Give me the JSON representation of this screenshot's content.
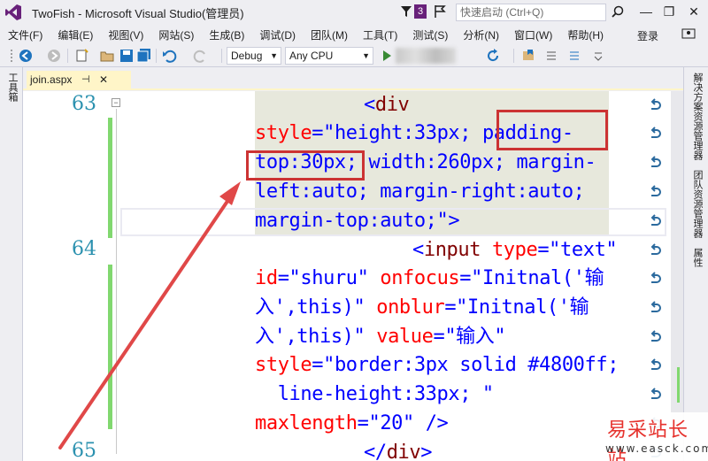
{
  "window": {
    "title": "TwoFish - Microsoft Visual Studio(管理员)",
    "notification_count": "3",
    "quick_launch_placeholder": "快速启动 (Ctrl+Q)",
    "minimize": "—",
    "restore": "❐",
    "close": "✕"
  },
  "menu": {
    "items": [
      "文件(F)",
      "编辑(E)",
      "视图(V)",
      "网站(S)",
      "生成(B)",
      "调试(D)",
      "团队(M)",
      "工具(T)",
      "测试(S)",
      "分析(N)",
      "窗口(W)",
      "帮助(H)"
    ],
    "login": "登录"
  },
  "toolbar": {
    "config": "Debug",
    "platform": "Any CPU"
  },
  "left_strip": {
    "label": "工具箱"
  },
  "right_strip": {
    "labels": [
      "解决方案资源管理器",
      "团队资源管理器",
      "属性"
    ]
  },
  "tab": {
    "filename": "join.aspx",
    "pin": "⊣",
    "close": "✕"
  },
  "editor": {
    "line_numbers": [
      "63",
      "64",
      "65"
    ],
    "lines": [
      [
        {
          "c": "bracket",
          "t": "<"
        },
        {
          "c": "tag",
          "t": "div"
        }
      ],
      [
        {
          "c": "attr",
          "t": "style"
        },
        {
          "c": "bracket",
          "t": "=\""
        },
        {
          "c": "val",
          "t": "height"
        },
        {
          "c": "bracket",
          "t": ":"
        },
        {
          "c": "val",
          "t": "33px; padding-"
        }
      ],
      [
        {
          "c": "val",
          "t": "top:30px; width:260px; margin-"
        }
      ],
      [
        {
          "c": "val",
          "t": "left:auto; margin-right:auto;"
        }
      ],
      [
        {
          "c": "val",
          "t": "margin-top:auto;"
        },
        {
          "c": "bracket",
          "t": "\">"
        }
      ],
      [
        {
          "c": "bracket",
          "t": "<"
        },
        {
          "c": "tag",
          "t": "input "
        },
        {
          "c": "attr",
          "t": "type"
        },
        {
          "c": "bracket",
          "t": "=\""
        },
        {
          "c": "val",
          "t": "text"
        },
        {
          "c": "bracket",
          "t": "\""
        }
      ],
      [
        {
          "c": "attr",
          "t": "id"
        },
        {
          "c": "bracket",
          "t": "=\""
        },
        {
          "c": "val",
          "t": "shuru"
        },
        {
          "c": "bracket",
          "t": "\" "
        },
        {
          "c": "attr",
          "t": "onfocus"
        },
        {
          "c": "bracket",
          "t": "=\""
        },
        {
          "c": "val",
          "t": "Initnal('输"
        }
      ],
      [
        {
          "c": "val",
          "t": "入',this)"
        },
        {
          "c": "bracket",
          "t": "\" "
        },
        {
          "c": "attr",
          "t": "onblur"
        },
        {
          "c": "bracket",
          "t": "=\""
        },
        {
          "c": "val",
          "t": "Initnal('输"
        }
      ],
      [
        {
          "c": "val",
          "t": "入',this)"
        },
        {
          "c": "bracket",
          "t": "\" "
        },
        {
          "c": "attr",
          "t": "value"
        },
        {
          "c": "bracket",
          "t": "=\""
        },
        {
          "c": "val",
          "t": "输入"
        },
        {
          "c": "bracket",
          "t": "\""
        }
      ],
      [
        {
          "c": "attr",
          "t": "style"
        },
        {
          "c": "bracket",
          "t": "=\""
        },
        {
          "c": "val",
          "t": "border:3px solid #4800ff;"
        }
      ],
      [
        {
          "c": "val",
          "t": "  line-height:33px; "
        },
        {
          "c": "bracket",
          "t": "\""
        }
      ],
      [
        {
          "c": "attr",
          "t": "maxlength"
        },
        {
          "c": "bracket",
          "t": "=\""
        },
        {
          "c": "val",
          "t": "20"
        },
        {
          "c": "bracket",
          "t": "\" />"
        }
      ],
      [
        {
          "c": "bracket",
          "t": "</"
        },
        {
          "c": "tag",
          "t": "div"
        },
        {
          "c": "bracket",
          "t": ">"
        }
      ]
    ]
  },
  "watermark": {
    "brand": "易采站长站",
    "url": "www.easck.com"
  },
  "colors": {
    "accent": "#68217a",
    "annotation": "#cc3333",
    "line_number": "#2b91af",
    "change_bar": "#81d86f"
  }
}
